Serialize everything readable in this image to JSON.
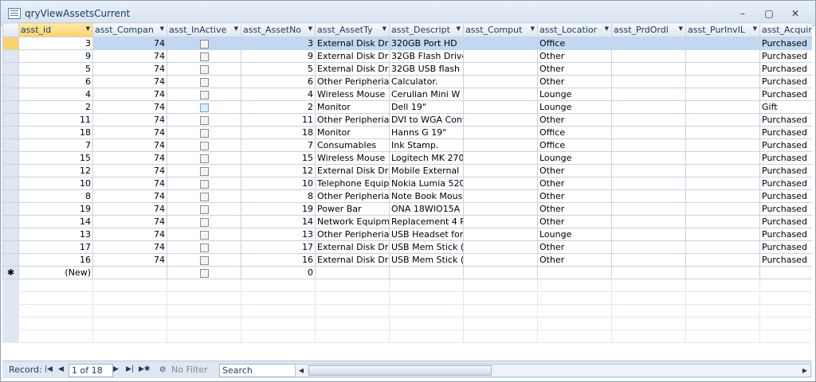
{
  "window": {
    "title": "qryViewAssetsCurrent",
    "minimize": "–",
    "restore": "▢",
    "close": "✕"
  },
  "columns": [
    "asst_id",
    "asst_Compan",
    "asst_InActive",
    "asst_AssetNo",
    "asst_AssetTy",
    "asst_Descript",
    "asst_Comput",
    "asst_Locatior",
    "asst_PrdOrdl",
    "asst_PurInvIL",
    "asst_Acquir"
  ],
  "rows": [
    {
      "id": "3",
      "company": "74",
      "assetno": "3",
      "type": "External Disk Dr",
      "desc": "320GB Port HD",
      "comp": "",
      "loc": "Office",
      "prd": "",
      "pur": "",
      "acq": "Purchased"
    },
    {
      "id": "9",
      "company": "74",
      "assetno": "9",
      "type": "External Disk Dr",
      "desc": "32GB Flash Drive",
      "comp": "",
      "loc": "Other",
      "prd": "",
      "pur": "",
      "acq": "Purchased"
    },
    {
      "id": "5",
      "company": "74",
      "assetno": "5",
      "type": "External Disk Dr",
      "desc": "32GB USB flash I",
      "comp": "",
      "loc": "Other",
      "prd": "",
      "pur": "",
      "acq": "Purchased"
    },
    {
      "id": "6",
      "company": "74",
      "assetno": "6",
      "type": "Other Peripheria",
      "desc": "Calculator.",
      "comp": "",
      "loc": "Other",
      "prd": "",
      "pur": "",
      "acq": "Purchased"
    },
    {
      "id": "4",
      "company": "74",
      "assetno": "4",
      "type": "Wireless Mouse",
      "desc": "Cerulian Mini W",
      "comp": "",
      "loc": "Lounge",
      "prd": "",
      "pur": "",
      "acq": "Purchased"
    },
    {
      "id": "2",
      "company": "74",
      "assetno": "2",
      "type": "Monitor",
      "desc": "Dell 19\"",
      "comp": "",
      "loc": "Lounge",
      "prd": "",
      "pur": "",
      "acq": "Gift"
    },
    {
      "id": "11",
      "company": "74",
      "assetno": "11",
      "type": "Other Peripheria",
      "desc": "DVI to WGA Conv",
      "comp": "",
      "loc": "Other",
      "prd": "",
      "pur": "",
      "acq": "Purchased"
    },
    {
      "id": "18",
      "company": "74",
      "assetno": "18",
      "type": "Monitor",
      "desc": "Hanns G  19\"",
      "comp": "",
      "loc": "Office",
      "prd": "",
      "pur": "",
      "acq": "Purchased"
    },
    {
      "id": "7",
      "company": "74",
      "assetno": "7",
      "type": "Consumables",
      "desc": "Ink Stamp.",
      "comp": "",
      "loc": "Office",
      "prd": "",
      "pur": "",
      "acq": "Purchased"
    },
    {
      "id": "15",
      "company": "74",
      "assetno": "15",
      "type": "Wireless Mouse",
      "desc": "Logitech MK 270",
      "comp": "",
      "loc": "Lounge",
      "prd": "",
      "pur": "",
      "acq": "Purchased"
    },
    {
      "id": "12",
      "company": "74",
      "assetno": "12",
      "type": "External Disk Dr",
      "desc": "Mobile External",
      "comp": "",
      "loc": "Other",
      "prd": "",
      "pur": "",
      "acq": "Purchased"
    },
    {
      "id": "10",
      "company": "74",
      "assetno": "10",
      "type": "Telephone Equip",
      "desc": "Nokia Lumia 520",
      "comp": "",
      "loc": "Other",
      "prd": "",
      "pur": "",
      "acq": "Purchased"
    },
    {
      "id": "8",
      "company": "74",
      "assetno": "8",
      "type": "Other Peripheria",
      "desc": "Note Book Mous",
      "comp": "",
      "loc": "Other",
      "prd": "",
      "pur": "",
      "acq": "Purchased"
    },
    {
      "id": "19",
      "company": "74",
      "assetno": "19",
      "type": "Power Bar",
      "desc": "ONA 18WIO15A",
      "comp": "",
      "loc": "Other",
      "prd": "",
      "pur": "",
      "acq": "Purchased"
    },
    {
      "id": "14",
      "company": "74",
      "assetno": "14",
      "type": "Network Equipm",
      "desc": "Replacement 4 P",
      "comp": "",
      "loc": "Other",
      "prd": "",
      "pur": "",
      "acq": "Purchased"
    },
    {
      "id": "13",
      "company": "74",
      "assetno": "13",
      "type": "Other Peripheria",
      "desc": "USB Headset for",
      "comp": "",
      "loc": "Lounge",
      "prd": "",
      "pur": "",
      "acq": "Purchased"
    },
    {
      "id": "17",
      "company": "74",
      "assetno": "17",
      "type": "External Disk Dr",
      "desc": "USB Mem Stick (I",
      "comp": "",
      "loc": "Other",
      "prd": "",
      "pur": "",
      "acq": "Purchased"
    },
    {
      "id": "16",
      "company": "74",
      "assetno": "16",
      "type": "External Disk Dr",
      "desc": "USB Mem Stick (V",
      "comp": "",
      "loc": "Other",
      "prd": "",
      "pur": "",
      "acq": "Purchased"
    }
  ],
  "new_row": {
    "marker": "✱",
    "id": "(New)",
    "assetno": "0"
  },
  "status": {
    "record_label": "Record:",
    "first": "|◀",
    "prev": "◀",
    "position": "1 of 18",
    "next": "▶",
    "last": "▶|",
    "new": "▶✱",
    "no_filter": "No Filter",
    "search": "Search"
  }
}
